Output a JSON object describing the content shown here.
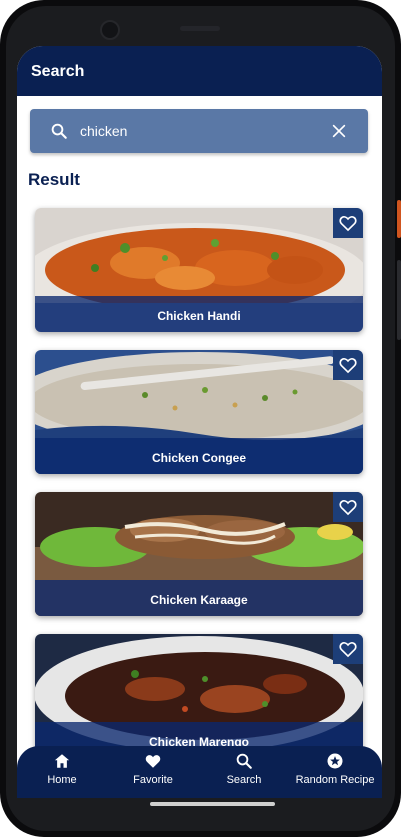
{
  "appbar": {
    "title": "Search"
  },
  "search": {
    "value": "chicken"
  },
  "results_title": "Result",
  "results": [
    {
      "label": "Chicken Handi"
    },
    {
      "label": "Chicken Congee"
    },
    {
      "label": "Chicken Karaage"
    },
    {
      "label": "Chicken Marengo"
    }
  ],
  "bottom_nav": {
    "items": [
      {
        "label": "Home",
        "icon": "home-icon"
      },
      {
        "label": "Favorite",
        "icon": "heart-icon"
      },
      {
        "label": "Search",
        "icon": "search-icon"
      },
      {
        "label": "Random Recipe",
        "icon": "star-circle-icon"
      }
    ]
  },
  "colors": {
    "primary": "#0a2052",
    "search_bg": "#5a78a6",
    "card_overlay": "#0a286e"
  }
}
